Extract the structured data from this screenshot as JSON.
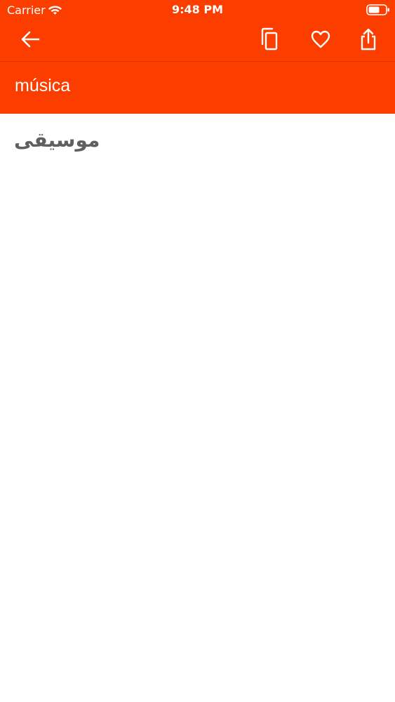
{
  "status_bar": {
    "carrier": "Carrier",
    "time": "9:48 PM"
  },
  "toolbar": {
    "back_icon": "arrow-left-icon",
    "copy_icon": "copy-icon",
    "favorite_icon": "heart-icon",
    "share_icon": "share-icon"
  },
  "entry": {
    "word": "música",
    "translation": "موسیقی"
  },
  "colors": {
    "accent": "#fb3d00",
    "text_on_accent": "#ffffff",
    "translation_text": "#5f5f5f",
    "background": "#ffffff"
  }
}
